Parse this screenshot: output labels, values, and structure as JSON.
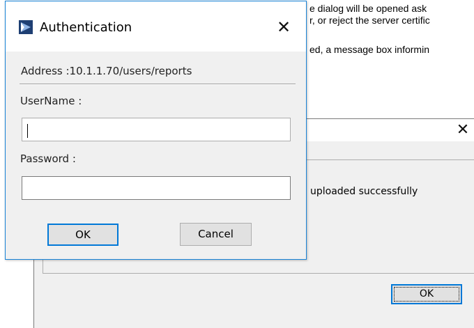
{
  "document": {
    "line1": "e dialog will be opened ask",
    "line2": "r, or reject the server certific",
    "line3": "ed, a message box informin"
  },
  "message_dialog": {
    "message": "uploaded successfully",
    "ok_label": "OK"
  },
  "auth_dialog": {
    "title": "Authentication",
    "address": "Address :10.1.1.70/users/reports",
    "username_label": "UserName :",
    "username_value": "",
    "password_label": "Password :",
    "password_value": "",
    "ok_label": "OK",
    "cancel_label": "Cancel"
  },
  "colors": {
    "accent": "#0078d7",
    "dialog_bg": "#f0f0f0",
    "button_bg": "#e1e1e1",
    "app_icon": "#1e3f73"
  }
}
